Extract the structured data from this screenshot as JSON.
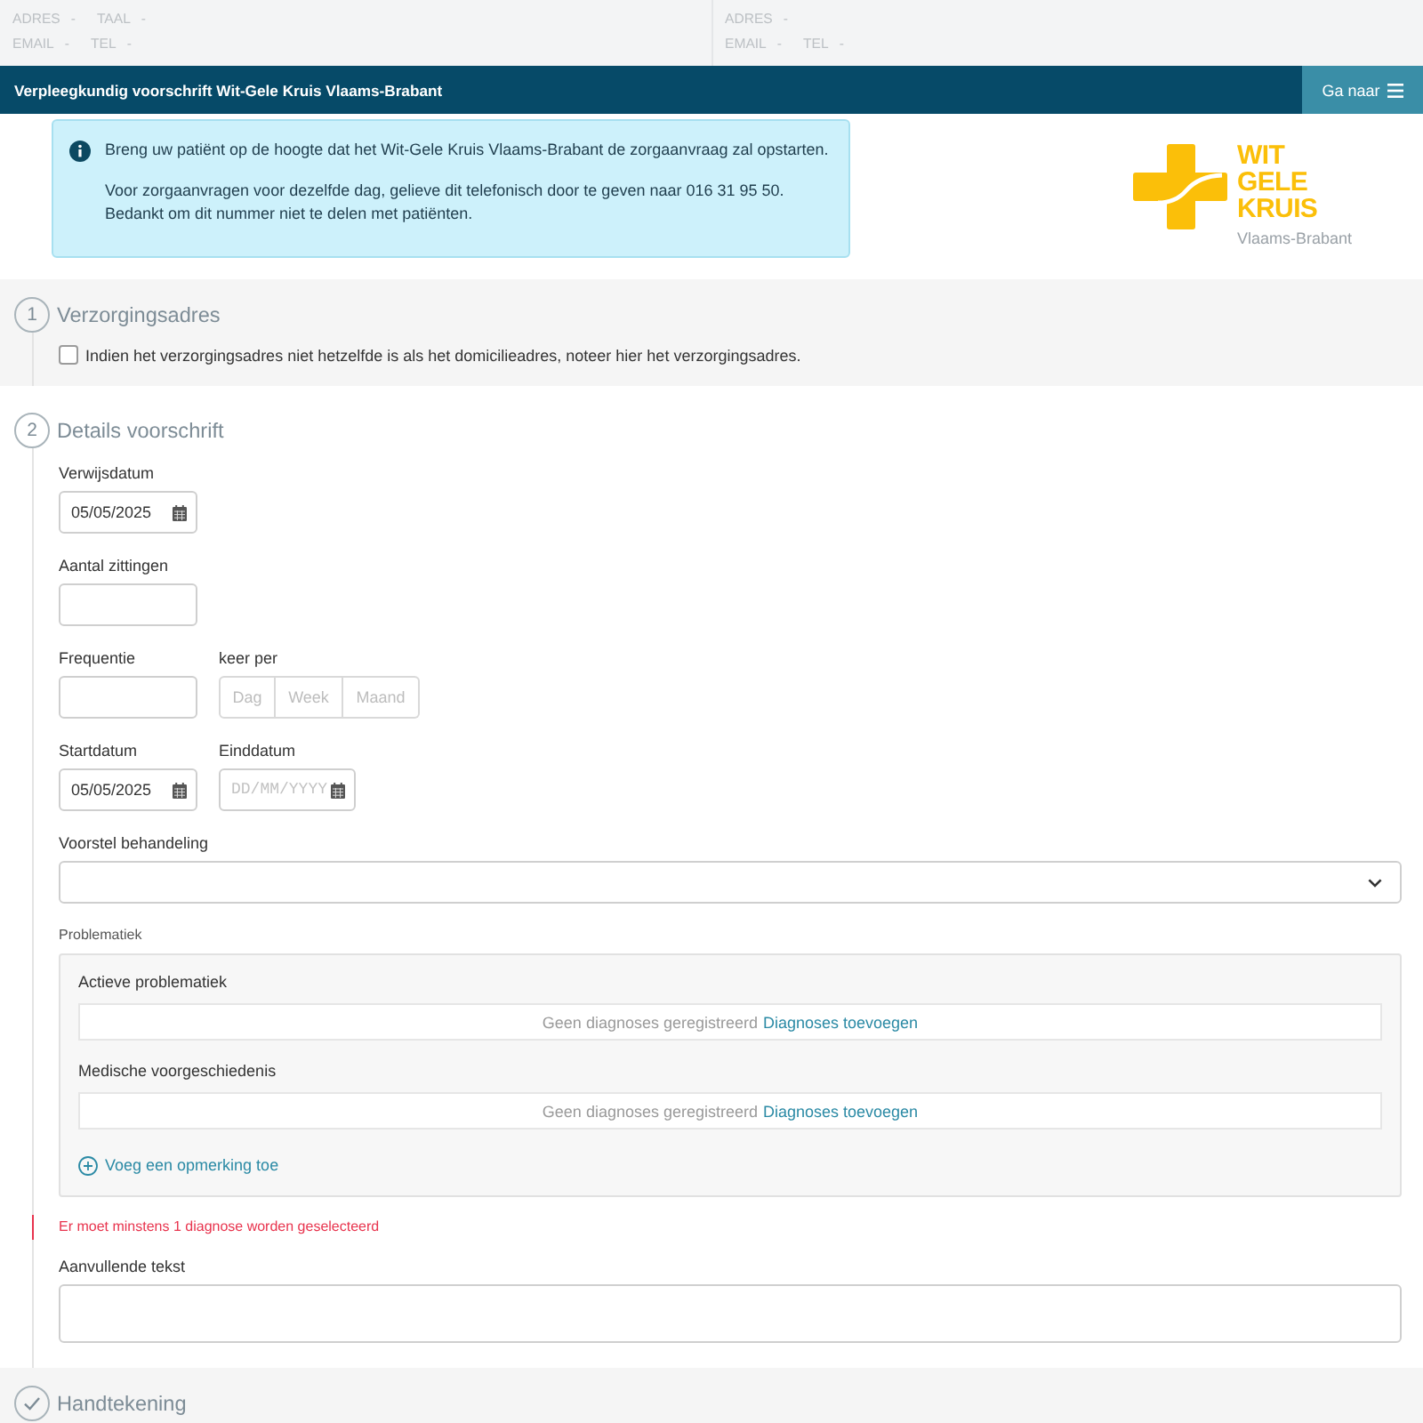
{
  "contact_header": {
    "columns": [
      {
        "rows": [
          [
            {
              "label": "ADRES",
              "value": "-"
            },
            {
              "label": "TAAL",
              "value": "-"
            }
          ],
          [
            {
              "label": "EMAIL",
              "value": "-"
            },
            {
              "label": "TEL",
              "value": "-"
            }
          ]
        ]
      },
      {
        "rows": [
          [
            {
              "label": "ADRES",
              "value": "-"
            }
          ],
          [
            {
              "label": "EMAIL",
              "value": "-"
            },
            {
              "label": "TEL",
              "value": "-"
            }
          ]
        ]
      }
    ]
  },
  "title_bar": {
    "title": "Verpleegkundig voorschrift Wit-Gele Kruis Vlaams-Brabant",
    "menu_button": "Ga naar"
  },
  "info_alert": {
    "paragraphs": [
      [
        "Breng uw patiënt op de hoogte dat het Wit-Gele Kruis Vlaams-Brabant de zorgaanvraag zal opstarten."
      ],
      [
        "Voor zorgaanvragen voor dezelfde dag, gelieve dit telefonisch door te geven naar 016 31 95 50.",
        "Bedankt om dit nummer niet te delen met patiënten."
      ]
    ]
  },
  "logo": {
    "wordmark": [
      "WIT",
      "GELE",
      "KRUIS"
    ],
    "region": "Vlaams-Brabant"
  },
  "steps": [
    {
      "kind": "address",
      "marker": {
        "kind": "number",
        "text": "1"
      },
      "title": "Verzorgingsadres",
      "checkbox": {
        "label": "Indien het verzorgingsadres niet hetzelfde is als het domicilieadres, noteer hier het verzorgingsadres.",
        "checked": false
      }
    },
    {
      "kind": "details",
      "marker": {
        "kind": "number",
        "text": "2"
      },
      "title": "Details voorschrift",
      "rows": [
        {
          "fields": [
            {
              "kind": "date",
              "label": "Verwijsdatum",
              "value": "05/05/2025"
            }
          ]
        },
        {
          "fields": [
            {
              "kind": "text",
              "label": "Aantal zittingen"
            }
          ]
        },
        {
          "fields": [
            {
              "kind": "text",
              "label": "Frequentie"
            },
            {
              "kind": "segmented",
              "label": "keer per",
              "options": [
                {
                  "label": "Dag",
                  "selected": false
                },
                {
                  "label": "Week",
                  "selected": false
                },
                {
                  "label": "Maand",
                  "selected": false
                }
              ]
            }
          ]
        },
        {
          "fields": [
            {
              "kind": "date",
              "label": "Startdatum",
              "value": "05/05/2025"
            },
            {
              "kind": "date",
              "label": "Einddatum",
              "placeholder": "DD/MM/YYYY"
            }
          ]
        },
        {
          "fields": [
            {
              "kind": "select",
              "label": "Voorstel behandeling"
            }
          ]
        }
      ],
      "problems": {
        "label": "Problematiek",
        "groups": [
          {
            "title": "Actieve problematiek",
            "empty_text": "Geen diagnoses geregistreerd",
            "link": "Diagnoses toevoegen"
          },
          {
            "title": "Medische voorgeschiedenis",
            "empty_text": "Geen diagnoses geregistreerd",
            "link": "Diagnoses toevoegen"
          }
        ],
        "add_comment": "Voeg een opmerking toe"
      },
      "error": "Er moet minstens 1 diagnose worden geselecteerd",
      "extra_text": {
        "label": "Aanvullende tekst"
      }
    },
    {
      "kind": "signature",
      "marker": {
        "kind": "check"
      },
      "title": "Handtekening"
    }
  ]
}
